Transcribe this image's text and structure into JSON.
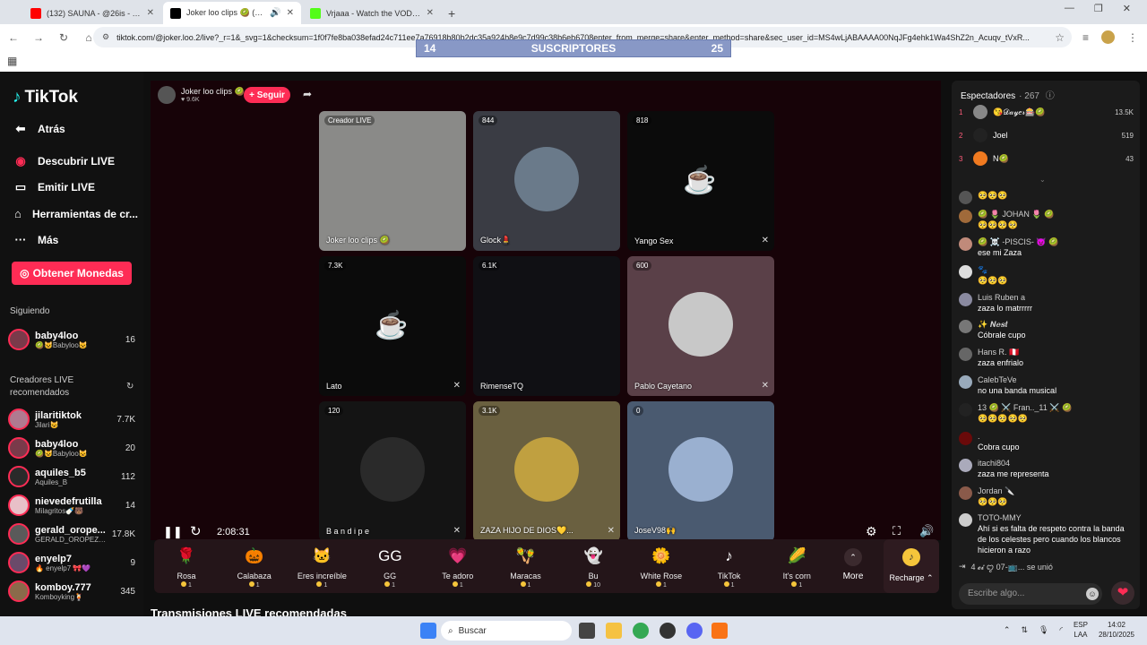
{
  "browser": {
    "tabs": [
      {
        "title": "(132) SAUNA - @26is - YouTube",
        "color": "#ff0000"
      },
      {
        "title": "Joker loo clips 🥝 (@joker.l",
        "color": "#000000",
        "active": true
      },
      {
        "title": "Vrjaaa - Watch the VOD on Kic",
        "color": "#53fc18"
      }
    ],
    "url": "tiktok.com/@joker.loo.2/live?_r=1&_svg=1&checksum=1f0f7fe8ba038efad24c711ee7a76918b80b2dc35a924b8e9c7d99c38b6eb6708enter_from_merge=share&enter_method=share&sec_user_id=MS4wLjABAAAA00NqJFg4ehk1Wa4ShZ2n_Acuqv_tVxR..."
  },
  "subs_overlay": {
    "left": "14",
    "label": "SUSCRIPTORES",
    "right": "25"
  },
  "sidebar": {
    "logo": "TikTok",
    "nav": [
      "Atrás",
      "Descubrir LIVE",
      "Emitir LIVE",
      "Herramientas de cr...",
      "Más"
    ],
    "coins_button": "Obtener Monedas",
    "following_title": "Siguiendo",
    "following": [
      {
        "name": "baby4loo",
        "sub": "🥝😺Babyloo😺",
        "count": "16"
      }
    ],
    "recommended_title": "Creadores LIVE recomendados",
    "creators": [
      {
        "name": "jilaritiktok",
        "sub": "Jilari😺",
        "count": "7.7K"
      },
      {
        "name": "baby4loo",
        "sub": "🥝😺Babyloo😺",
        "count": "20"
      },
      {
        "name": "aquiles_b5",
        "sub": "Aquiles_B",
        "count": "112"
      },
      {
        "name": "nievedefrutilla",
        "sub": "Milagritos🍼🐻",
        "count": "14"
      },
      {
        "name": "gerald_orope...",
        "sub": "GERALD_OROPEZA...",
        "count": "17.8K"
      },
      {
        "name": "enyelp7",
        "sub": "🔥 enyelp7 🎀💜",
        "count": "9"
      },
      {
        "name": "komboy.777",
        "sub": "Komboyking🍹",
        "count": "345"
      }
    ]
  },
  "host": {
    "name": "Joker loo clips 🥝",
    "likes": "9.6K",
    "follow": "+ Seguir"
  },
  "grid": [
    {
      "badge": "Creador LIVE",
      "name": "Joker loo clips 🥝",
      "kind": "video"
    },
    {
      "badge": "844",
      "name": "Glock💄",
      "kind": "avatar"
    },
    {
      "badge": "818",
      "name": "Yango Sex",
      "kind": "cup",
      "muted": true
    },
    {
      "badge": "7.3K",
      "name": "Lato",
      "kind": "cup",
      "muted": true
    },
    {
      "badge": "6.1K",
      "name": "RimenseTQ",
      "kind": "dark"
    },
    {
      "badge": "600",
      "name": "Pablo Cayetano",
      "kind": "avatar",
      "muted": true
    },
    {
      "badge": "120",
      "name": "B a n d i p e",
      "kind": "avatar",
      "muted": true
    },
    {
      "badge": "3.1K",
      "name": "ZAZA HIJO DE DIOS💛...",
      "kind": "avatar",
      "muted": true
    },
    {
      "badge": "0",
      "name": "JoseV98🙌",
      "kind": "avatar"
    }
  ],
  "player": {
    "time": "2:08:31"
  },
  "gifts": [
    {
      "label": "Rosa",
      "price": "1",
      "icon": "🌹"
    },
    {
      "label": "Calabaza",
      "price": "1",
      "icon": "🎃"
    },
    {
      "label": "Eres increíble",
      "price": "1",
      "icon": "🐱"
    },
    {
      "label": "GG",
      "price": "1",
      "icon": "GG"
    },
    {
      "label": "Te adoro",
      "price": "1",
      "icon": "💗"
    },
    {
      "label": "Maracas",
      "price": "1",
      "icon": "🪇"
    },
    {
      "label": "Bu",
      "price": "10",
      "icon": "👻"
    },
    {
      "label": "White Rose",
      "price": "1",
      "icon": "🌼"
    },
    {
      "label": "TikTok",
      "price": "1",
      "icon": "♪"
    },
    {
      "label": "It's corn",
      "price": "1",
      "icon": "🌽"
    }
  ],
  "more_label": "More",
  "recharge_label": "Recharge ⌃",
  "recommended_heading": "Transmisiones LIVE recomendadas",
  "chat": {
    "title": "Espectadores",
    "viewer_count": "· 267",
    "top": [
      {
        "rank": "1",
        "name": "😘𝒟𝒶𝓎𝑒𝓇🎰🥝",
        "score": "13.5K"
      },
      {
        "rank": "2",
        "name": "Joel",
        "score": "519"
      },
      {
        "rank": "3",
        "name": "N🥝",
        "score": "43"
      }
    ],
    "messages": [
      {
        "user": "",
        "text": "🥺🥺🥺"
      },
      {
        "user": "🥝 🌷 JOHAN 🌷 🥝",
        "text": "🥺🥺🥺🥺"
      },
      {
        "user": "🥝 ☠️ -PISCIS- 😈 🥝",
        "text": "ese mi Zaza"
      },
      {
        "user": "🐾",
        "text": "🥺🥺🥺"
      },
      {
        "user": "Luis Ruben a",
        "text": "zaza lo matrrrrr"
      },
      {
        "user": "✨ 𝑵𝒆𝒔𝒕",
        "text": "Cóbrale cupo"
      },
      {
        "user": "Hans R. 🇵🇪",
        "text": "zaza enfrialo"
      },
      {
        "user": "CalebTeVe",
        "text": "no una banda musical"
      },
      {
        "user": "13 🥝 ⚔️ Fran.._11 ⚔️ 🥝",
        "text": "🥺🥺🥺🥺🥺"
      },
      {
        "user": ".",
        "text": "Cobra cupo"
      },
      {
        "user": "itachi804",
        "text": "zaza me representa"
      },
      {
        "user": "Jordan 🔪",
        "text": "🥺🥺🥺"
      },
      {
        "user": "TOTO-MMY",
        "text": "Ahí si es falta de respeto contra la banda de los celestes pero cuando los blancos hicieron a razo"
      }
    ],
    "join_text": "4 𝓮𝓲 ꨄ 07-📺... se unió",
    "input_placeholder": "Escribe algo..."
  },
  "taskbar": {
    "search": "Buscar",
    "lang": "ESP\nLAA",
    "time": "14:02",
    "date": "28/10/2025"
  }
}
